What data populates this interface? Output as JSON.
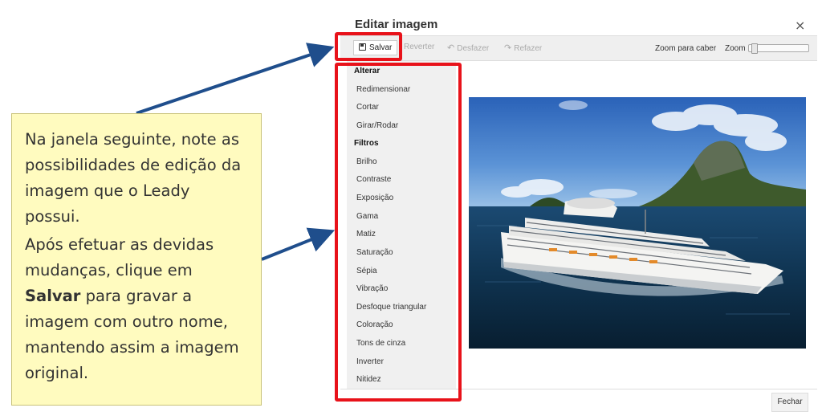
{
  "dialog": {
    "title": "Editar imagem",
    "close_glyph": "×"
  },
  "toolbar": {
    "save_label": "Salvar",
    "revert_label": "Reverter",
    "undo_label": "Desfazer",
    "redo_label": "Refazer",
    "zoom_fit_label": "Zoom para caber",
    "zoom_label": "Zoom",
    "zoom_level": 0.05
  },
  "sidebar": {
    "group_alter": "Alterar",
    "alter_items": [
      "Redimensionar",
      "Cortar",
      "Girar/Rodar"
    ],
    "group_filters": "Filtros",
    "filter_items": [
      "Brilho",
      "Contraste",
      "Exposição",
      "Gama",
      "Matiz",
      "Saturação",
      "Sépia",
      "Vibração",
      "Desfoque triangular",
      "Coloração",
      "Tons de cinza",
      "Inverter",
      "Nitidez"
    ]
  },
  "footer": {
    "close_button": "Fechar"
  },
  "callout": {
    "para1": "Na janela seguinte, note as possibilidades de edição da imagem que o Leady possui.",
    "para2_before": "Após efetuar as devidas mudanças, clique em",
    "para2_bold": "Salvar",
    "para2_after": "para gravar a imagem com outro nome, mantendo assim a imagem original."
  },
  "colors": {
    "highlight_red": "#e8121a",
    "arrow_blue": "#1f4e8c",
    "callout_bg": "#fffbbf"
  }
}
